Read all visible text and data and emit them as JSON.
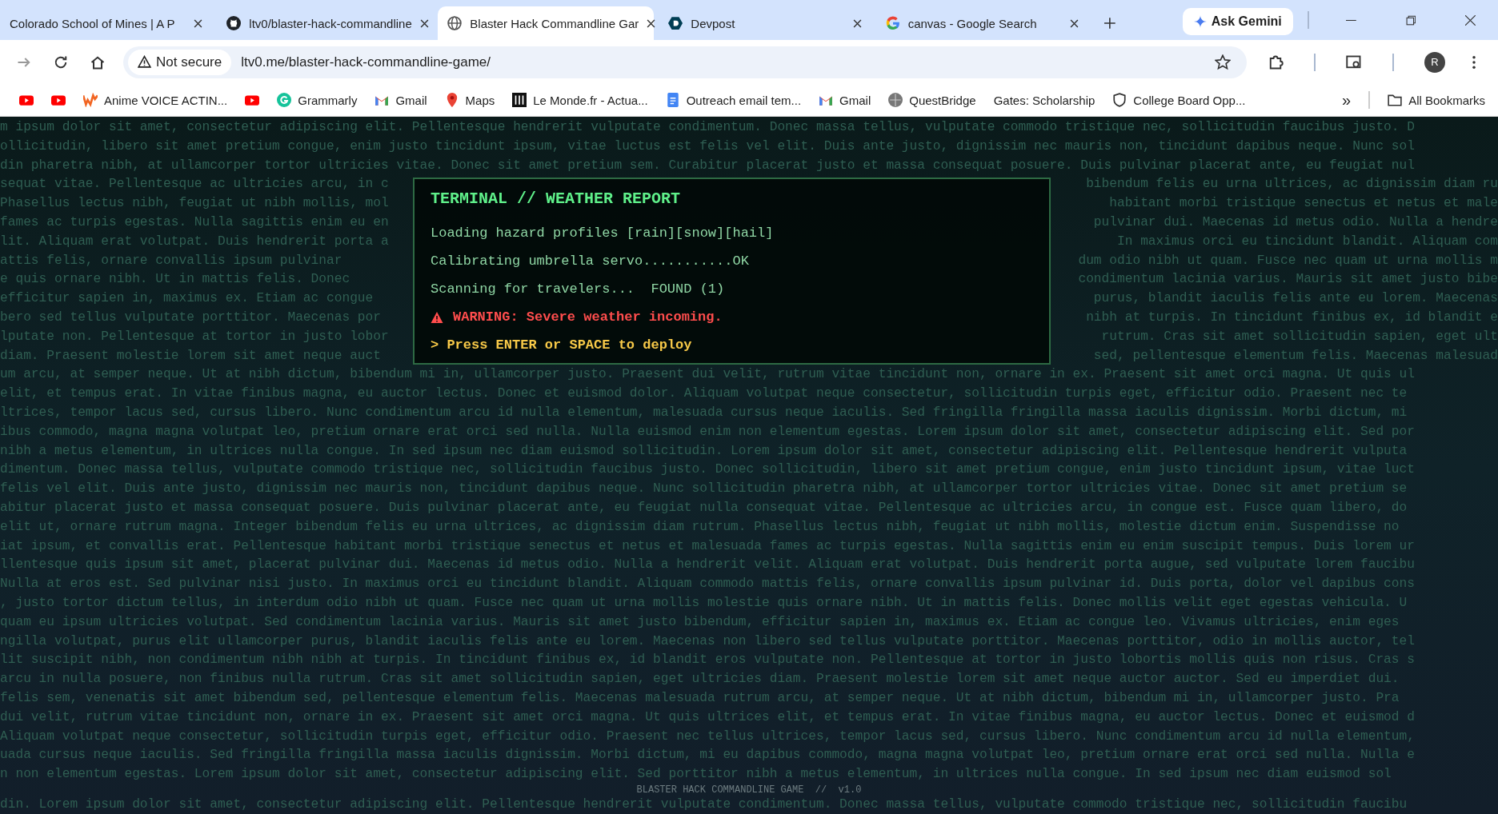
{
  "tabs": [
    {
      "label": "Colorado School of Mines | A P",
      "selected": false
    },
    {
      "label": "ltv0/blaster-hack-commandline",
      "selected": false
    },
    {
      "label": "Blaster Hack Commandline Gar",
      "selected": true
    },
    {
      "label": "Devpost",
      "selected": false
    },
    {
      "label": "canvas - Google Search",
      "selected": false
    }
  ],
  "gemini_button": "Ask Gemini",
  "address_bar": {
    "security": "Not secure",
    "url": "ltv0.me/blaster-hack-commandline-game/",
    "profile": "R"
  },
  "bookmarks": [
    {
      "kind": "icon"
    },
    {
      "kind": "icon"
    },
    {
      "kind": "link",
      "label": "Anime VOICE ACTIN..."
    },
    {
      "kind": "icon"
    },
    {
      "kind": "link",
      "label": "Grammarly"
    },
    {
      "kind": "link",
      "label": "Gmail"
    },
    {
      "kind": "link",
      "label": "Maps"
    },
    {
      "kind": "link",
      "label": "Le Monde.fr - Actua..."
    },
    {
      "kind": "link",
      "label": "Outreach email tem..."
    },
    {
      "kind": "link",
      "label": "Gmail"
    },
    {
      "kind": "link",
      "label": "QuestBridge"
    },
    {
      "kind": "link",
      "label": "Gates: Scholarship"
    },
    {
      "kind": "link",
      "label": "College Board Opp..."
    }
  ],
  "overflow": "»",
  "all_bookmarks": "All Bookmarks",
  "background_text": [
    [
      "m ipsum dolor sit amet, consectetur adipiscing elit. Pellentesque hendrerit vulputate condimentum. Donec massa tellus, vulputate commodo tristique nec, sollicitudin faucibus justo. D"
    ],
    [
      "ollicitudin, libero sit amet pretium congue, enim justo tincidunt ipsum, vitae luctus est felis vel elit. Duis ante justo, dignissim nec mauris non, tincidunt dapibus neque. Nunc sol"
    ],
    [
      "din pharetra nibh, at ullamcorper tortor ultricies vitae. Donec sit amet pretium sem. Curabitur placerat justo et massa consequat posuere. Duis pulvinar placerat ante, eu feugiat nul"
    ],
    [
      "sequat vitae. Pellentesque ac ultricies arcu, in c",
      "bibendum felis eu urna ultrices, ac dignissim diam ru"
    ],
    [
      "Phasellus lectus nibh, feugiat ut nibh mollis, mol",
      "habitant morbi tristique senectus et netus et male"
    ],
    [
      "fames ac turpis egestas. Nulla sagittis enim eu en",
      "pulvinar dui. Maecenas id metus odio. Nulla a hendre"
    ],
    [
      "lit. Aliquam erat volutpat. Duis hendrerit porta a",
      "In maximus orci eu tincidunt blandit. Aliquam com"
    ],
    [
      "attis felis, ornare convallis ipsum pulvinar",
      "dum odio nibh ut quam. Fusce nec quam ut urna mollis m"
    ],
    [
      "e quis ornare nibh. Ut in mattis felis. Donec",
      "condimentum lacinia varius. Mauris sit amet justo bibe"
    ],
    [
      "efficitur sapien in, maximus ex. Etiam ac congue",
      "purus, blandit iaculis felis ante eu lorem. Maecenas"
    ],
    [
      "bero sed tellus vulputate porttitor. Maecenas por",
      "nibh at turpis. In tincidunt finibus ex, id blandit e"
    ],
    [
      "lputate non. Pellentesque at tortor in justo lobor",
      "rutrum. Cras sit amet sollicitudin sapien, eget ult"
    ],
    [
      "diam. Praesent molestie lorem sit amet neque auct",
      "sed, pellentesque elementum felis. Maecenas malesuad"
    ],
    [
      "um arcu, at semper neque. Ut at nibh dictum, bibendum mi in, ullamcorper justo. Praesent dui velit, rutrum vitae tincidunt non, ornare in ex. Praesent sit amet orci magna. Ut quis ul"
    ],
    [
      "elit, et tempus erat. In vitae finibus magna, eu auctor lectus. Donec et euismod dolor. Aliquam volutpat neque consectetur, sollicitudin turpis eget, efficitur odio. Praesent nec te"
    ],
    [
      "ltrices, tempor lacus sed, cursus libero. Nunc condimentum arcu id nulla elementum, malesuada cursus neque iaculis. Sed fringilla fringilla massa iaculis dignissim. Morbi dictum, mi"
    ],
    [
      "ibus commodo, magna magna volutpat leo, pretium ornare erat orci sed nulla. Nulla euismod enim non elementum egestas. Lorem ipsum dolor sit amet, consectetur adipiscing elit. Sed por"
    ],
    [
      "nibh a metus elementum, in ultrices nulla congue. In sed ipsum nec diam euismod sollicitudin. Lorem ipsum dolor sit amet, consectetur adipiscing elit. Pellentesque hendrerit vulputa"
    ],
    [
      "dimentum. Donec massa tellus, vulputate commodo tristique nec, sollicitudin faucibus justo. Donec sollicitudin, libero sit amet pretium congue, enim justo tincidunt ipsum, vitae luct"
    ],
    [
      "felis vel elit. Duis ante justo, dignissim nec mauris non, tincidunt dapibus neque. Nunc sollicitudin pharetra nibh, at ullamcorper tortor ultricies vitae. Donec sit amet pretium se"
    ],
    [
      "abitur placerat justo et massa consequat posuere. Duis pulvinar placerat ante, eu feugiat nulla consequat vitae. Pellentesque ac ultricies arcu, in congue est. Fusce quam libero, do"
    ],
    [
      "elit ut, ornare rutrum magna. Integer bibendum felis eu urna ultrices, ac dignissim diam rutrum. Phasellus lectus nibh, feugiat ut nibh mollis, molestie dictum enim. Suspendisse no"
    ],
    [
      "iat ipsum, et convallis erat. Pellentesque habitant morbi tristique senectus et netus et malesuada fames ac turpis egestas. Nulla sagittis enim eu enim suscipit tempus. Duis lorem ur"
    ],
    [
      "llentesque quis ipsum sit amet, placerat pulvinar dui. Maecenas id metus odio. Nulla a hendrerit velit. Aliquam erat volutpat. Duis hendrerit porta augue, sed vulputate lorem faucibu"
    ],
    [
      "Nulla at eros est. Sed pulvinar nisi justo. In maximus orci eu tincidunt blandit. Aliquam commodo mattis felis, ornare convallis ipsum pulvinar id. Duis porta, dolor vel dapibus cons"
    ],
    [
      ", justo tortor dictum tellus, in interdum odio nibh ut quam. Fusce nec quam ut urna mollis molestie quis ornare nibh. Ut in mattis felis. Donec mollis velit eget egestas vehicula. U"
    ],
    [
      "quam eu ipsum ultricies volutpat. Sed condimentum lacinia varius. Mauris sit amet justo bibendum, efficitur sapien in, maximus ex. Etiam ac congue leo. Vivamus ultricies, enim eges"
    ],
    [
      "ngilla volutpat, purus elit ullamcorper purus, blandit iaculis felis ante eu lorem. Maecenas non libero sed tellus vulputate porttitor. Maecenas porttitor, odio in mollis auctor, tel"
    ],
    [
      "lit suscipit nibh, non condimentum nibh nibh at turpis. In tincidunt finibus ex, id blandit eros vulputate non. Pellentesque at tortor in justo lobortis mollis quis non risus. Cras s"
    ],
    [
      "arcu in nulla posuere, non finibus nulla rutrum. Cras sit amet sollicitudin sapien, eget ultricies diam. Praesent molestie lorem sit amet neque auctor auctor. Sed eu imperdiet dui."
    ],
    [
      "felis sem, venenatis sit amet bibendum sed, pellentesque elementum felis. Maecenas malesuada rutrum arcu, at semper neque. Ut at nibh dictum, bibendum mi in, ullamcorper justo. Pra"
    ],
    [
      "dui velit, rutrum vitae tincidunt non, ornare in ex. Praesent sit amet orci magna. Ut quis ultrices elit, et tempus erat. In vitae finibus magna, eu auctor lectus. Donec et euismod d"
    ],
    [
      "Aliquam volutpat neque consectetur, sollicitudin turpis eget, efficitur odio. Praesent nec tellus ultrices, tempor lacus sed, cursus libero. Nunc condimentum arcu id nulla elementum,"
    ],
    [
      "uada cursus neque iaculis. Sed fringilla fringilla massa iaculis dignissim. Morbi dictum, mi eu dapibus commodo, magna magna volutpat leo, pretium ornare erat orci sed nulla. Nulla e"
    ],
    [
      "n non elementum egestas. Lorem ipsum dolor sit amet, consectetur adipiscing elit. Sed porttitor nibh a metus elementum, in ultrices nulla congue. In sed ipsum nec diam euismod sol"
    ],
    [
      "din. Lorem ipsum dolor sit amet, consectetur adipiscing elit. Pellentesque hendrerit vulputate condimentum. Donec massa tellus, vulputate commodo tristique nec, sollicitudin faucibu"
    ]
  ],
  "terminal": {
    "title": "TERMINAL // WEATHER REPORT",
    "lines": [
      {
        "kind": "info",
        "text": "Loading hazard profiles [rain][snow][hail]"
      },
      {
        "kind": "info",
        "text": "Calibrating umbrella servo...........OK"
      },
      {
        "kind": "info",
        "text": "Scanning for travelers...  FOUND (1)"
      },
      {
        "kind": "warning",
        "text": "WARNING: Severe weather incoming."
      },
      {
        "kind": "prompt",
        "text": "> Press ENTER or SPACE to deploy"
      }
    ]
  },
  "footer": "BLASTER HACK COMMANDLINE GAME  //  v1.0"
}
